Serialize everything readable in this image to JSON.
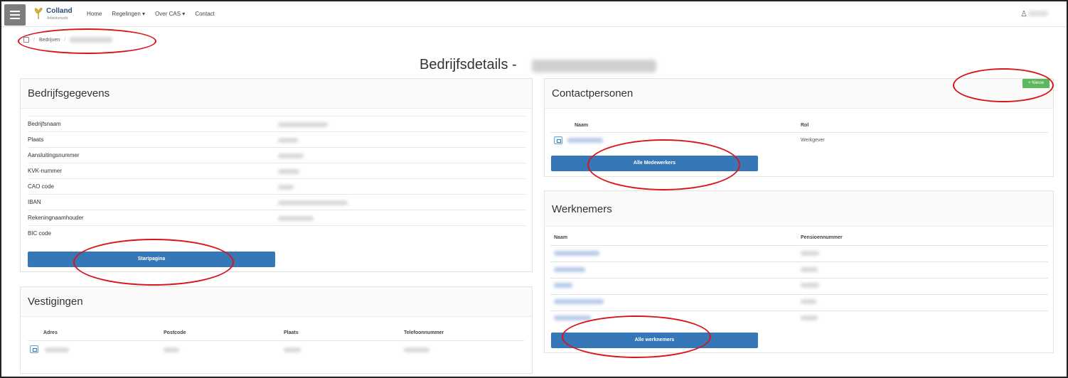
{
  "brand": {
    "name": "Colland",
    "sub": "Arbeidsmarkt"
  },
  "nav": {
    "items": [
      "Home",
      "Regelingen ▾",
      "Over CAS ▾",
      "Contact"
    ]
  },
  "breadcrumb": {
    "item1": "Bedrijven"
  },
  "title": "Bedrijfsdetails -",
  "bedrijfsgegevens": {
    "heading": "Bedrijfsgegevens",
    "fields": [
      "Bedrijfsnaam",
      "Plaats",
      "Aansluitingsnummer",
      "KVK-nummer",
      "CAO code",
      "IBAN",
      "Rekeningnaamhouder",
      "BIC code"
    ],
    "button": "Startpagina"
  },
  "vestigingen": {
    "heading": "Vestigingen",
    "columns": [
      "Adres",
      "Postcode",
      "Plaats",
      "Telefoonnummer"
    ]
  },
  "contactpersonen": {
    "heading": "Contactpersonen",
    "new_button": "+ Nieuw",
    "columns": [
      "Naam",
      "Rol"
    ],
    "row_role": "Werkgever",
    "button": "Alle Medewerkers"
  },
  "werknemers": {
    "heading": "Werknemers",
    "columns": [
      "Naam",
      "Pensioennummer"
    ],
    "button": "Alle werknemers"
  },
  "colors": {
    "primary": "#3677b8",
    "success": "#5cb85c",
    "annotation": "#d9151c"
  }
}
